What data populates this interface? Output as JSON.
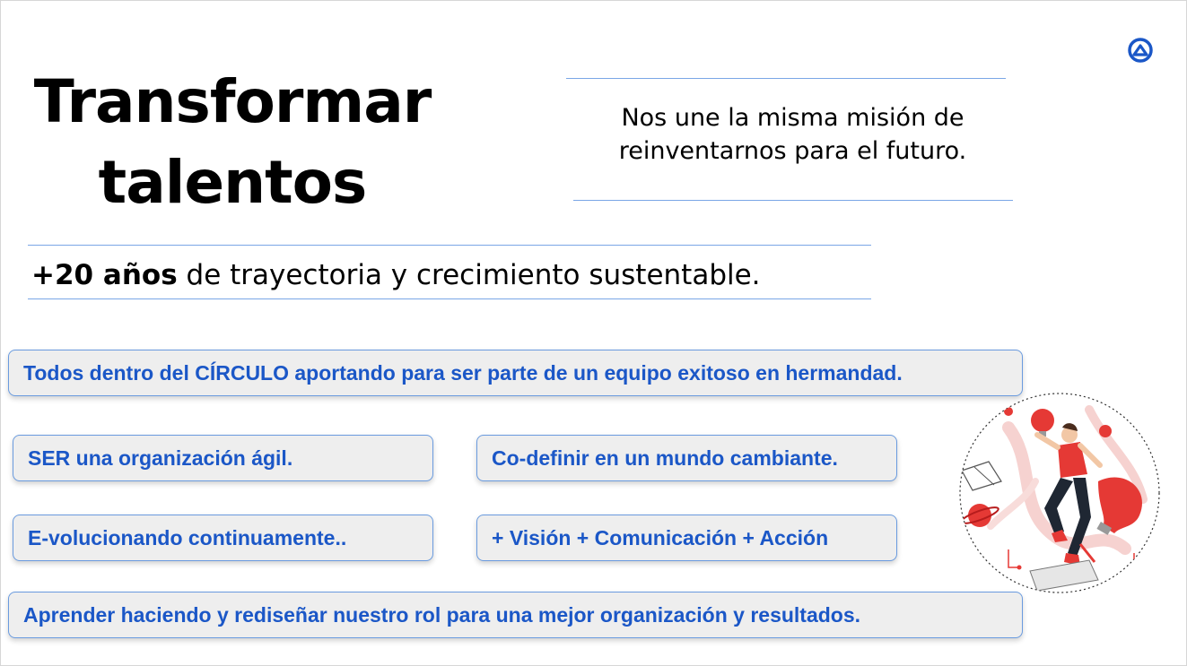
{
  "title": {
    "line1": "Transformar",
    "line2": "talentos"
  },
  "mission": {
    "text": "Nos une la misma misión de reinventarnos para el futuro."
  },
  "years": {
    "bold": "+20 años",
    "rest": " de trayectoria y crecimiento sustentable."
  },
  "pillars": {
    "circle": "Todos dentro del CÍRCULO aportando para ser parte de un equipo exitoso en hermandad.",
    "ser": "SER una organización ágil.",
    "codefinir": "Co-definir en un mundo cambiante.",
    "evolucionando": "E-volucionando continuamente..",
    "vision": "+ Visión + Comunicación + Acción",
    "aprender": "Aprender haciendo y rediseñar nuestro rol para una mejor organización y resultados."
  },
  "colors": {
    "accent": "#1b57c7",
    "line": "#7aa6e6",
    "pill_bg": "#eeeeee",
    "illustration_red": "#e53935"
  }
}
